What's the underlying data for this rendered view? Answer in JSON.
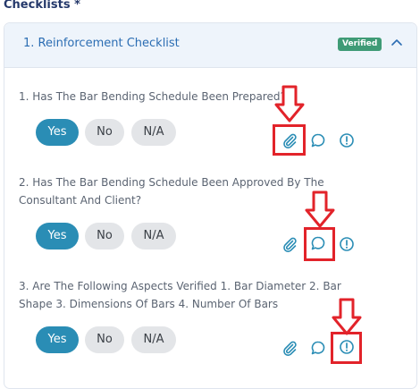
{
  "section_title": "Checklists *",
  "card": {
    "title": "1. Reinforcement Checklist",
    "badge": "Verified",
    "collapse_icon": "chevron-up-icon"
  },
  "colors": {
    "accent": "#2a8db5",
    "verified": "#3f9b76",
    "highlight": "#e2232a",
    "header_bg": "#eef4fb"
  },
  "questions": [
    {
      "text": "1. Has The Bar Bending Schedule Been Prepared?",
      "options": [
        "Yes",
        "No",
        "N/A"
      ],
      "selected": "Yes",
      "highlighted_icon": "attachment-icon"
    },
    {
      "text": "2. Has The Bar Bending Schedule Been Approved By The Consultant And Client?",
      "options": [
        "Yes",
        "No",
        "N/A"
      ],
      "selected": "Yes",
      "highlighted_icon": "comment-icon"
    },
    {
      "text": "3. Are The Following Aspects Verified 1. Bar Diameter 2. Bar Shape 3. Dimensions Of Bars 4. Number Of Bars",
      "options": [
        "Yes",
        "No",
        "N/A"
      ],
      "selected": "Yes",
      "highlighted_icon": "alert-icon"
    }
  ],
  "icons": [
    "attachment-icon",
    "comment-icon",
    "alert-icon"
  ]
}
